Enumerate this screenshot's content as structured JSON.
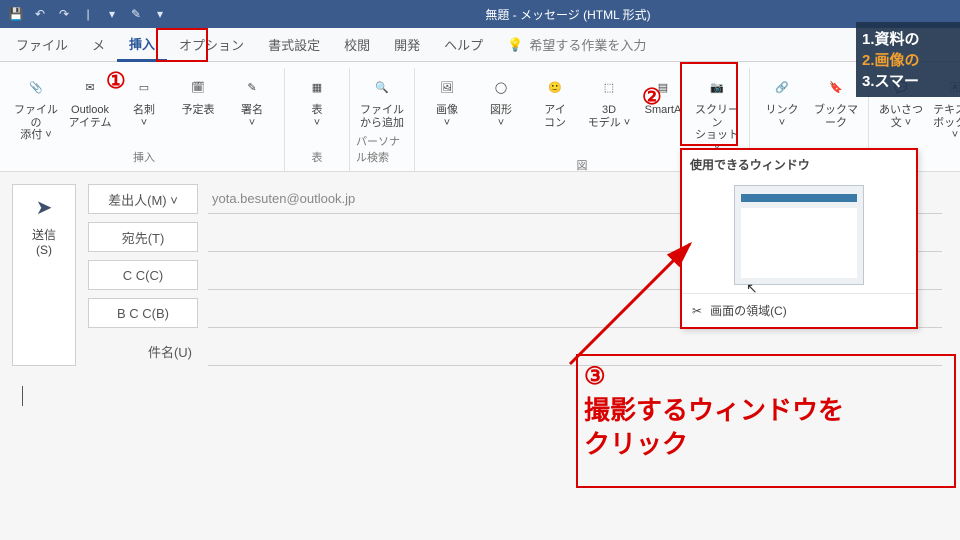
{
  "title": "無題 - メッセージ (HTML 形式)",
  "tabs": {
    "file": "ファイル",
    "m": "メ",
    "insert": "挿入",
    "options": "オプション",
    "format": "書式設定",
    "review": "校閲",
    "dev": "開発",
    "help": "ヘルプ",
    "tell": "希望する作業を入力"
  },
  "ribbon": {
    "insert_group": "挿入",
    "table_group": "表",
    "personal_group": "パーソナル検索",
    "figure_group": "図",
    "attach": "ファイルの\n添付 ˅",
    "outlook_item": "Outlook\nアイテム",
    "meishi": "名刺\n˅",
    "calendar": "予定表",
    "signature": "署名\n˅",
    "table": "表\n˅",
    "addfile": "ファイル\nから追加",
    "image": "画像\n˅",
    "shapes": "図形\n˅",
    "icons": "アイ\nコン",
    "model3d": "3D\nモデル ˅",
    "smartart": "SmartA",
    "screenshot": "スクリーン\nショット ˅",
    "link": "リンク\n˅",
    "bookmark": "ブックマーク",
    "greeting": "あいさつ\n文 ˅",
    "textbox": "テキスト\nボックス ˅"
  },
  "compose": {
    "send": "送信\n(S)",
    "from_btn": "差出人(M) ˅",
    "from_val": "yota.besuten@outlook.jp",
    "to": "宛先(T)",
    "cc": "C C(C)",
    "bcc": "B C C(B)",
    "subject": "件名(U)"
  },
  "dropdown": {
    "header": "使用できるウィンドウ",
    "region": "画面の領域(C)"
  },
  "annot": {
    "n1": "①",
    "n2": "②",
    "n3": "③",
    "text": "撮影するウィンドウを\nクリック"
  },
  "overlay": {
    "l1": "1.資料の",
    "l2": "2.画像の",
    "l3": "3.スマー"
  }
}
